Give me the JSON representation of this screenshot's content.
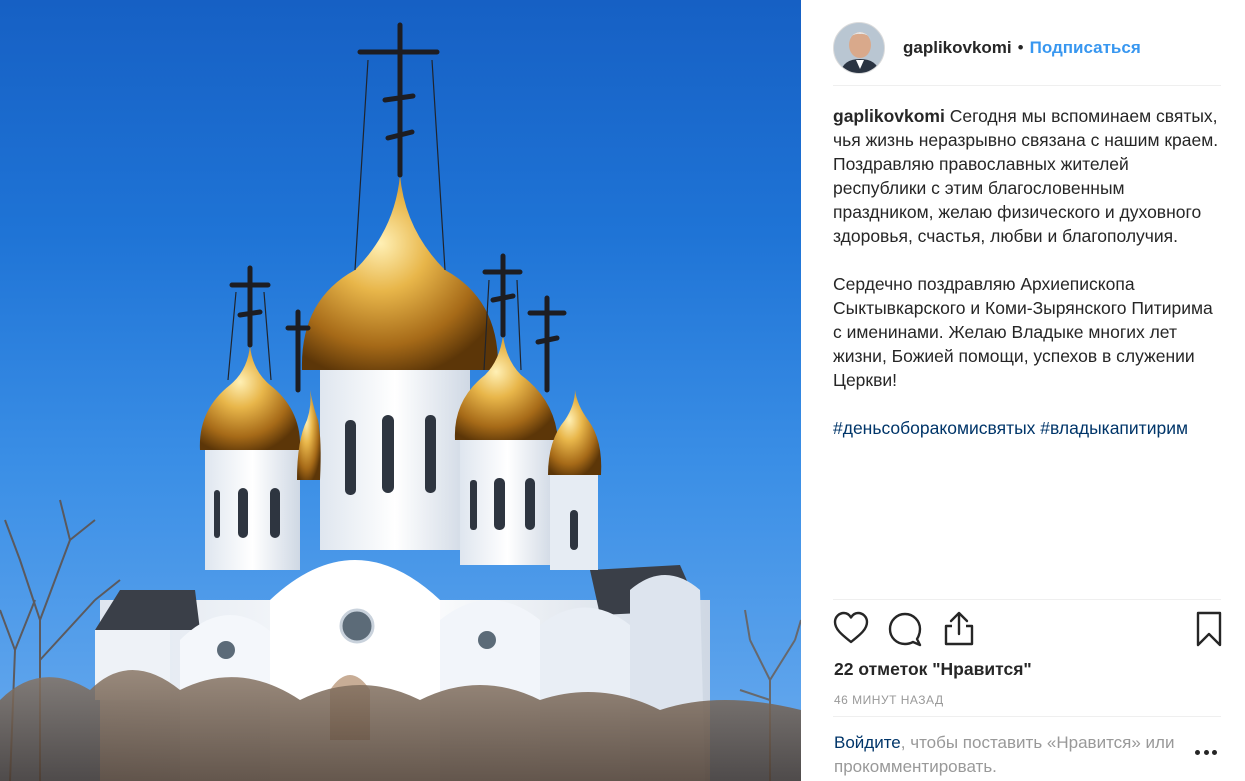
{
  "post": {
    "username": "gaplikovkomi",
    "separator": "•",
    "follow_label": "Подписаться",
    "caption_paragraphs": [
      "Сегодня мы вспоминаем святых, чья жизнь неразрывно связана с нашим краем. Поздравляю православных жителей республики с этим благословенным праздником, желаю физического и духовного здоровья, счастья, любви и благополучия.",
      "Сердечно поздравляю Архиепископа Сыктывкарского и Коми-Зырянского Питирима с именинами. Желаю Владыке многих лет жизни, Божией помощи, успехов в служении Церкви!"
    ],
    "hashtags": [
      "#деньсоборакомисвятых",
      "#владыкапитирим"
    ],
    "likes": "22 отметок \"Нравится\"",
    "time": "46 минут назад"
  },
  "footer": {
    "login_link": "Войдите",
    "login_text": ", чтобы поставить «Нравится» или прокомментировать."
  },
  "icons": {
    "like": "heart-icon",
    "comment": "comment-icon",
    "share": "share-icon",
    "save": "bookmark-icon",
    "more": "more-options-icon"
  },
  "colors": {
    "link_blue": "#3897f0",
    "hashtag_blue": "#003569",
    "text": "#262626",
    "muted": "#999999",
    "sky": "#1f74d6",
    "gold": "#d9a43a"
  }
}
